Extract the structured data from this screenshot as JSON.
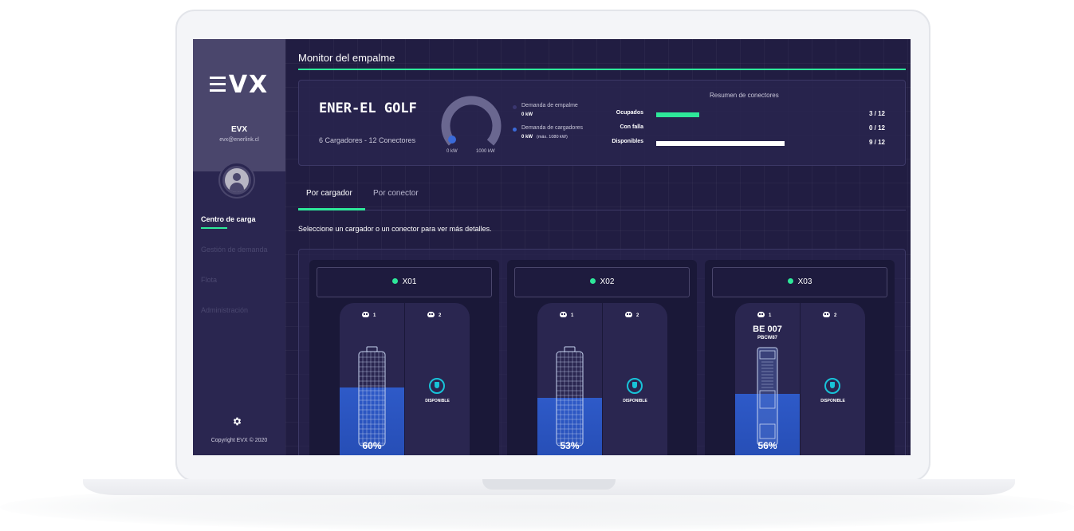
{
  "sidebar": {
    "logo": "EVX",
    "user_name": "EVX",
    "user_email": "evx@enerlink.cl",
    "nav": [
      {
        "label": "Centro de carga",
        "active": true
      },
      {
        "label": "Gestión de demanda",
        "active": false
      },
      {
        "label": "Flota",
        "active": false
      },
      {
        "label": "Administración",
        "active": false
      }
    ],
    "settings_icon": "gear-icon",
    "copyright": "Copyright EVX © 2020"
  },
  "page": {
    "title": "Monitor del empalme"
  },
  "summary": {
    "station_name": "ENER-EL GOLF",
    "station_sub": "6 Cargadores - 12 Conectores",
    "gauge": {
      "min_label": "0 kW",
      "max_label": "1000 kW",
      "value": 0
    },
    "legend": [
      {
        "label": "Demanda de empalme",
        "value": "0 kW",
        "extra": "",
        "color": "#3a3670"
      },
      {
        "label": "Demanda de cargadores",
        "value": "0 kW",
        "extra": "(máx. 1080 kW)",
        "color": "#3a6ad8"
      }
    ],
    "connectors": {
      "title": "Resumen de conectores",
      "rows": [
        {
          "label": "Ocupados",
          "count": "3 / 12",
          "fraction": 0.25,
          "color": "#2ee89a"
        },
        {
          "label": "Con falla",
          "count": "0 / 12",
          "fraction": 0,
          "color": "#e04848"
        },
        {
          "label": "Disponibles",
          "count": "9 / 12",
          "fraction": 0.75,
          "color": "#ffffff"
        }
      ]
    }
  },
  "tabs": [
    {
      "label": "Por cargador",
      "active": true
    },
    {
      "label": "Por conector",
      "active": false
    }
  ],
  "hint": "Seleccione un cargador o un conector para ver más detalles.",
  "chargers": [
    {
      "name": "X01",
      "status_color": "#2ee89a",
      "c1": "1",
      "c2": "2",
      "vehicle": "",
      "plate": "",
      "percent": "60%",
      "level": 0.6,
      "c2_status": "DISPONIBLE",
      "icon": "battery-icon"
    },
    {
      "name": "X02",
      "status_color": "#2ee89a",
      "c1": "1",
      "c2": "2",
      "vehicle": "",
      "plate": "",
      "percent": "53%",
      "level": 0.53,
      "c2_status": "DISPONIBLE",
      "icon": "battery-icon"
    },
    {
      "name": "X03",
      "status_color": "#2ee89a",
      "c1": "1",
      "c2": "2",
      "vehicle": "BE 007",
      "plate": "PBCW87",
      "percent": "56%",
      "level": 0.56,
      "c2_status": "DISPONIBLE",
      "icon": "bus-icon"
    }
  ]
}
